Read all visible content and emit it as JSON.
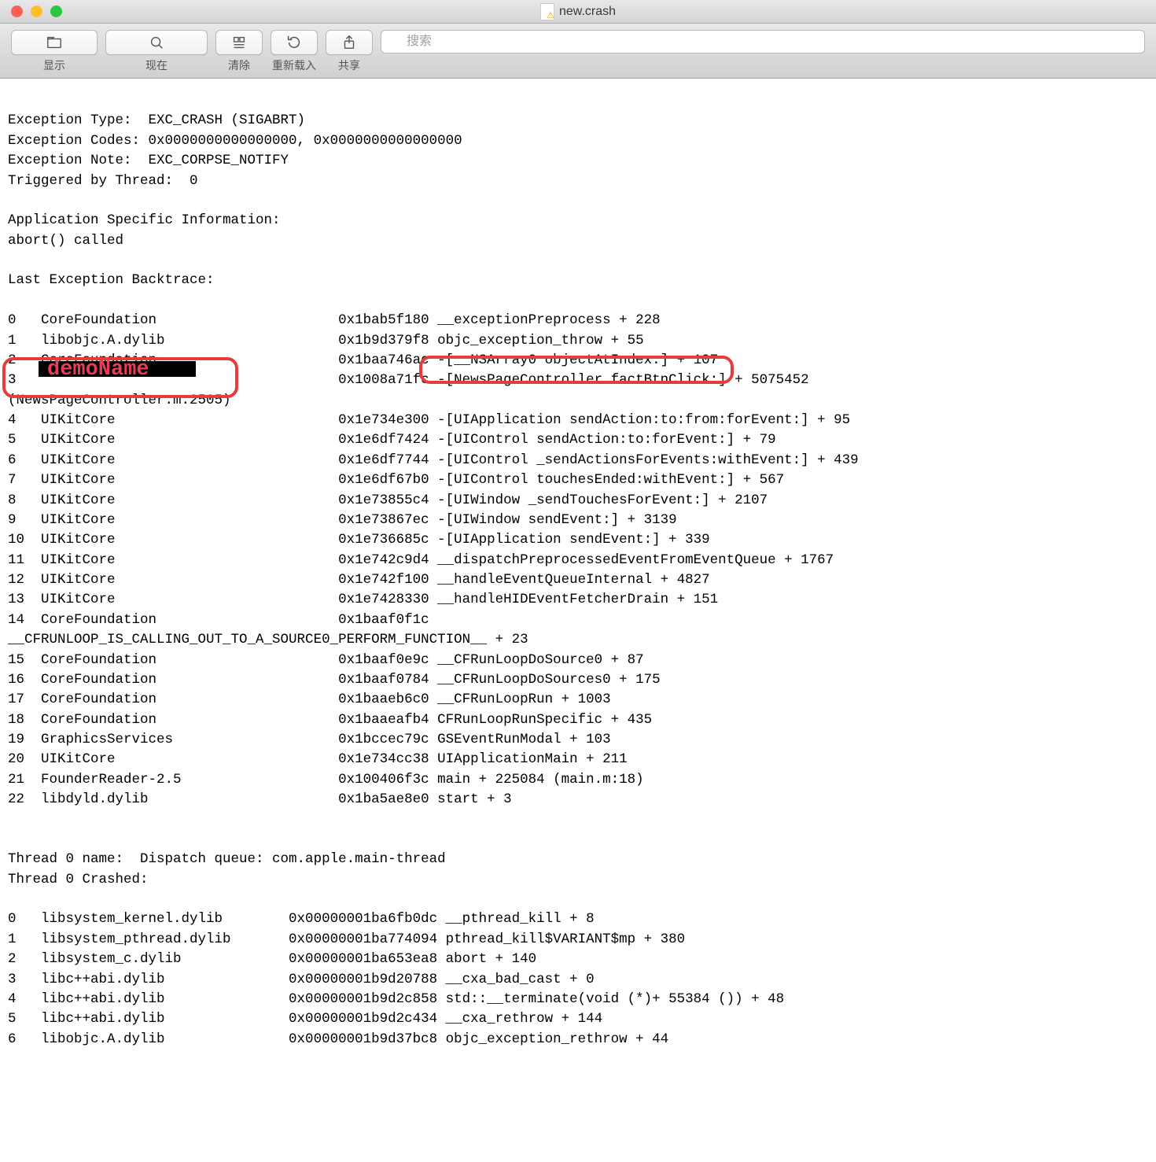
{
  "window": {
    "title": "new.crash"
  },
  "toolbar": {
    "show_label": "显示",
    "now_label": "现在",
    "clear_label": "清除",
    "reload_label": "重新载入",
    "share_label": "共享",
    "search_placeholder": "搜索"
  },
  "overlay": {
    "demo_name": "demoName"
  },
  "crash": {
    "header": "Exception Type:  EXC_CRASH (SIGABRT)\nException Codes: 0x0000000000000000, 0x0000000000000000\nException Note:  EXC_CORPSE_NOTIFY\nTriggered by Thread:  0\n\nApplication Specific Information:\nabort() called\n\nLast Exception Backtrace:",
    "backtrace": [
      "0   CoreFoundation                      0x1bab5f180 __exceptionPreprocess + 228",
      "1   libobjc.A.dylib                     0x1b9d379f8 objc_exception_throw + 55",
      "2   CoreFoundation                      0x1baa746ac -[__NSArray0 objectAtIndex:] + 107",
      "3                                       0x1008a71fc -[NewsPageController factBtnClick:] + 5075452",
      "(NewsPageController.m:2505)",
      "4   UIKitCore                           0x1e734e300 -[UIApplication sendAction:to:from:forEvent:] + 95",
      "5   UIKitCore                           0x1e6df7424 -[UIControl sendAction:to:forEvent:] + 79",
      "6   UIKitCore                           0x1e6df7744 -[UIControl _sendActionsForEvents:withEvent:] + 439",
      "7   UIKitCore                           0x1e6df67b0 -[UIControl touchesEnded:withEvent:] + 567",
      "8   UIKitCore                           0x1e73855c4 -[UIWindow _sendTouchesForEvent:] + 2107",
      "9   UIKitCore                           0x1e73867ec -[UIWindow sendEvent:] + 3139",
      "10  UIKitCore                           0x1e736685c -[UIApplication sendEvent:] + 339",
      "11  UIKitCore                           0x1e742c9d4 __dispatchPreprocessedEventFromEventQueue + 1767",
      "12  UIKitCore                           0x1e742f100 __handleEventQueueInternal + 4827",
      "13  UIKitCore                           0x1e7428330 __handleHIDEventFetcherDrain + 151",
      "14  CoreFoundation                      0x1baaf0f1c",
      "__CFRUNLOOP_IS_CALLING_OUT_TO_A_SOURCE0_PERFORM_FUNCTION__ + 23",
      "15  CoreFoundation                      0x1baaf0e9c __CFRunLoopDoSource0 + 87",
      "16  CoreFoundation                      0x1baaf0784 __CFRunLoopDoSources0 + 175",
      "17  CoreFoundation                      0x1baaeb6c0 __CFRunLoopRun + 1003",
      "18  CoreFoundation                      0x1baaeafb4 CFRunLoopRunSpecific + 435",
      "19  GraphicsServices                    0x1bccec79c GSEventRunModal + 103",
      "20  UIKitCore                           0x1e734cc38 UIApplicationMain + 211",
      "21  FounderReader-2.5                   0x100406f3c main + 225084 (main.m:18)",
      "22  libdyld.dylib                       0x1ba5ae8e0 start + 3"
    ],
    "thread_header": "Thread 0 name:  Dispatch queue: com.apple.main-thread\nThread 0 Crashed:",
    "thread": [
      "0   libsystem_kernel.dylib        0x00000001ba6fb0dc __pthread_kill + 8",
      "1   libsystem_pthread.dylib       0x00000001ba774094 pthread_kill$VARIANT$mp + 380",
      "2   libsystem_c.dylib             0x00000001ba653ea8 abort + 140",
      "3   libc++abi.dylib               0x00000001b9d20788 __cxa_bad_cast + 0",
      "4   libc++abi.dylib               0x00000001b9d2c858 std::__terminate(void (*)+ 55384 ()) + 48",
      "5   libc++abi.dylib               0x00000001b9d2c434 __cxa_rethrow + 144",
      "6   libobjc.A.dylib               0x00000001b9d37bc8 objc_exception_rethrow + 44"
    ]
  }
}
